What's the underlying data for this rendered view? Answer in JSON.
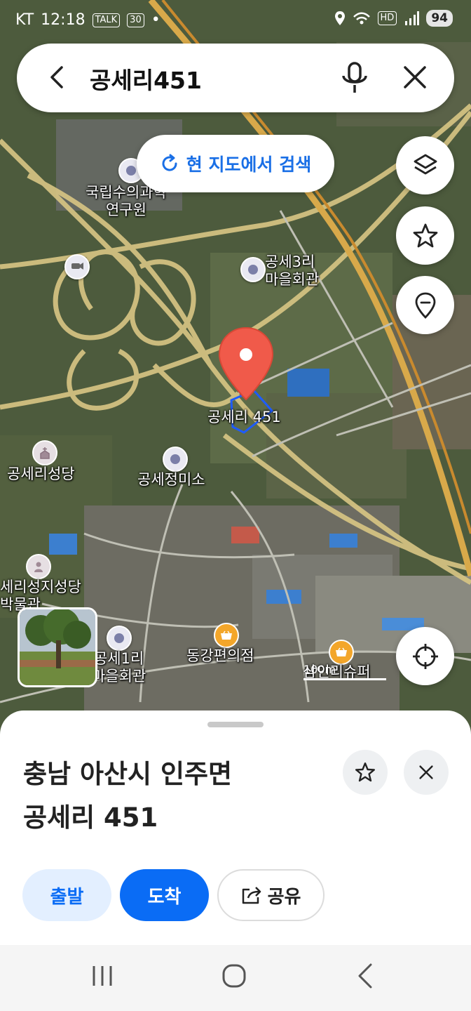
{
  "status_bar": {
    "carrier": "KT",
    "time": "12:18",
    "talk_badge": "TALK",
    "calendar_badge": "30",
    "hd_badge": "HD",
    "battery": "94"
  },
  "search": {
    "query": "공세리451"
  },
  "map": {
    "research_button": "현 지도에서 검색",
    "pin_label": "공세리 451",
    "scale_label": "100m",
    "labels": {
      "fish_research_1": "국립수의과학",
      "fish_research_2": "연구원",
      "village3_1": "공세3리",
      "village3_2": "마을회관",
      "cathedral": "공세리성당",
      "ricemill": "공세정미소",
      "museum_1": "세리성지성당",
      "museum_2": "박물관",
      "village1_1": "공세1리",
      "village1_2": "마을회관",
      "store1": "동강편의점",
      "store2": "삼인리슈퍼"
    }
  },
  "place": {
    "address_line1": "충남 아산시 인주면",
    "address_line2": "공세리 451",
    "depart_label": "출발",
    "arrive_label": "도착",
    "share_label": "공유"
  },
  "colors": {
    "accent": "#0a6cf5",
    "pin": "#f05a4a",
    "road": "#d9b870"
  }
}
